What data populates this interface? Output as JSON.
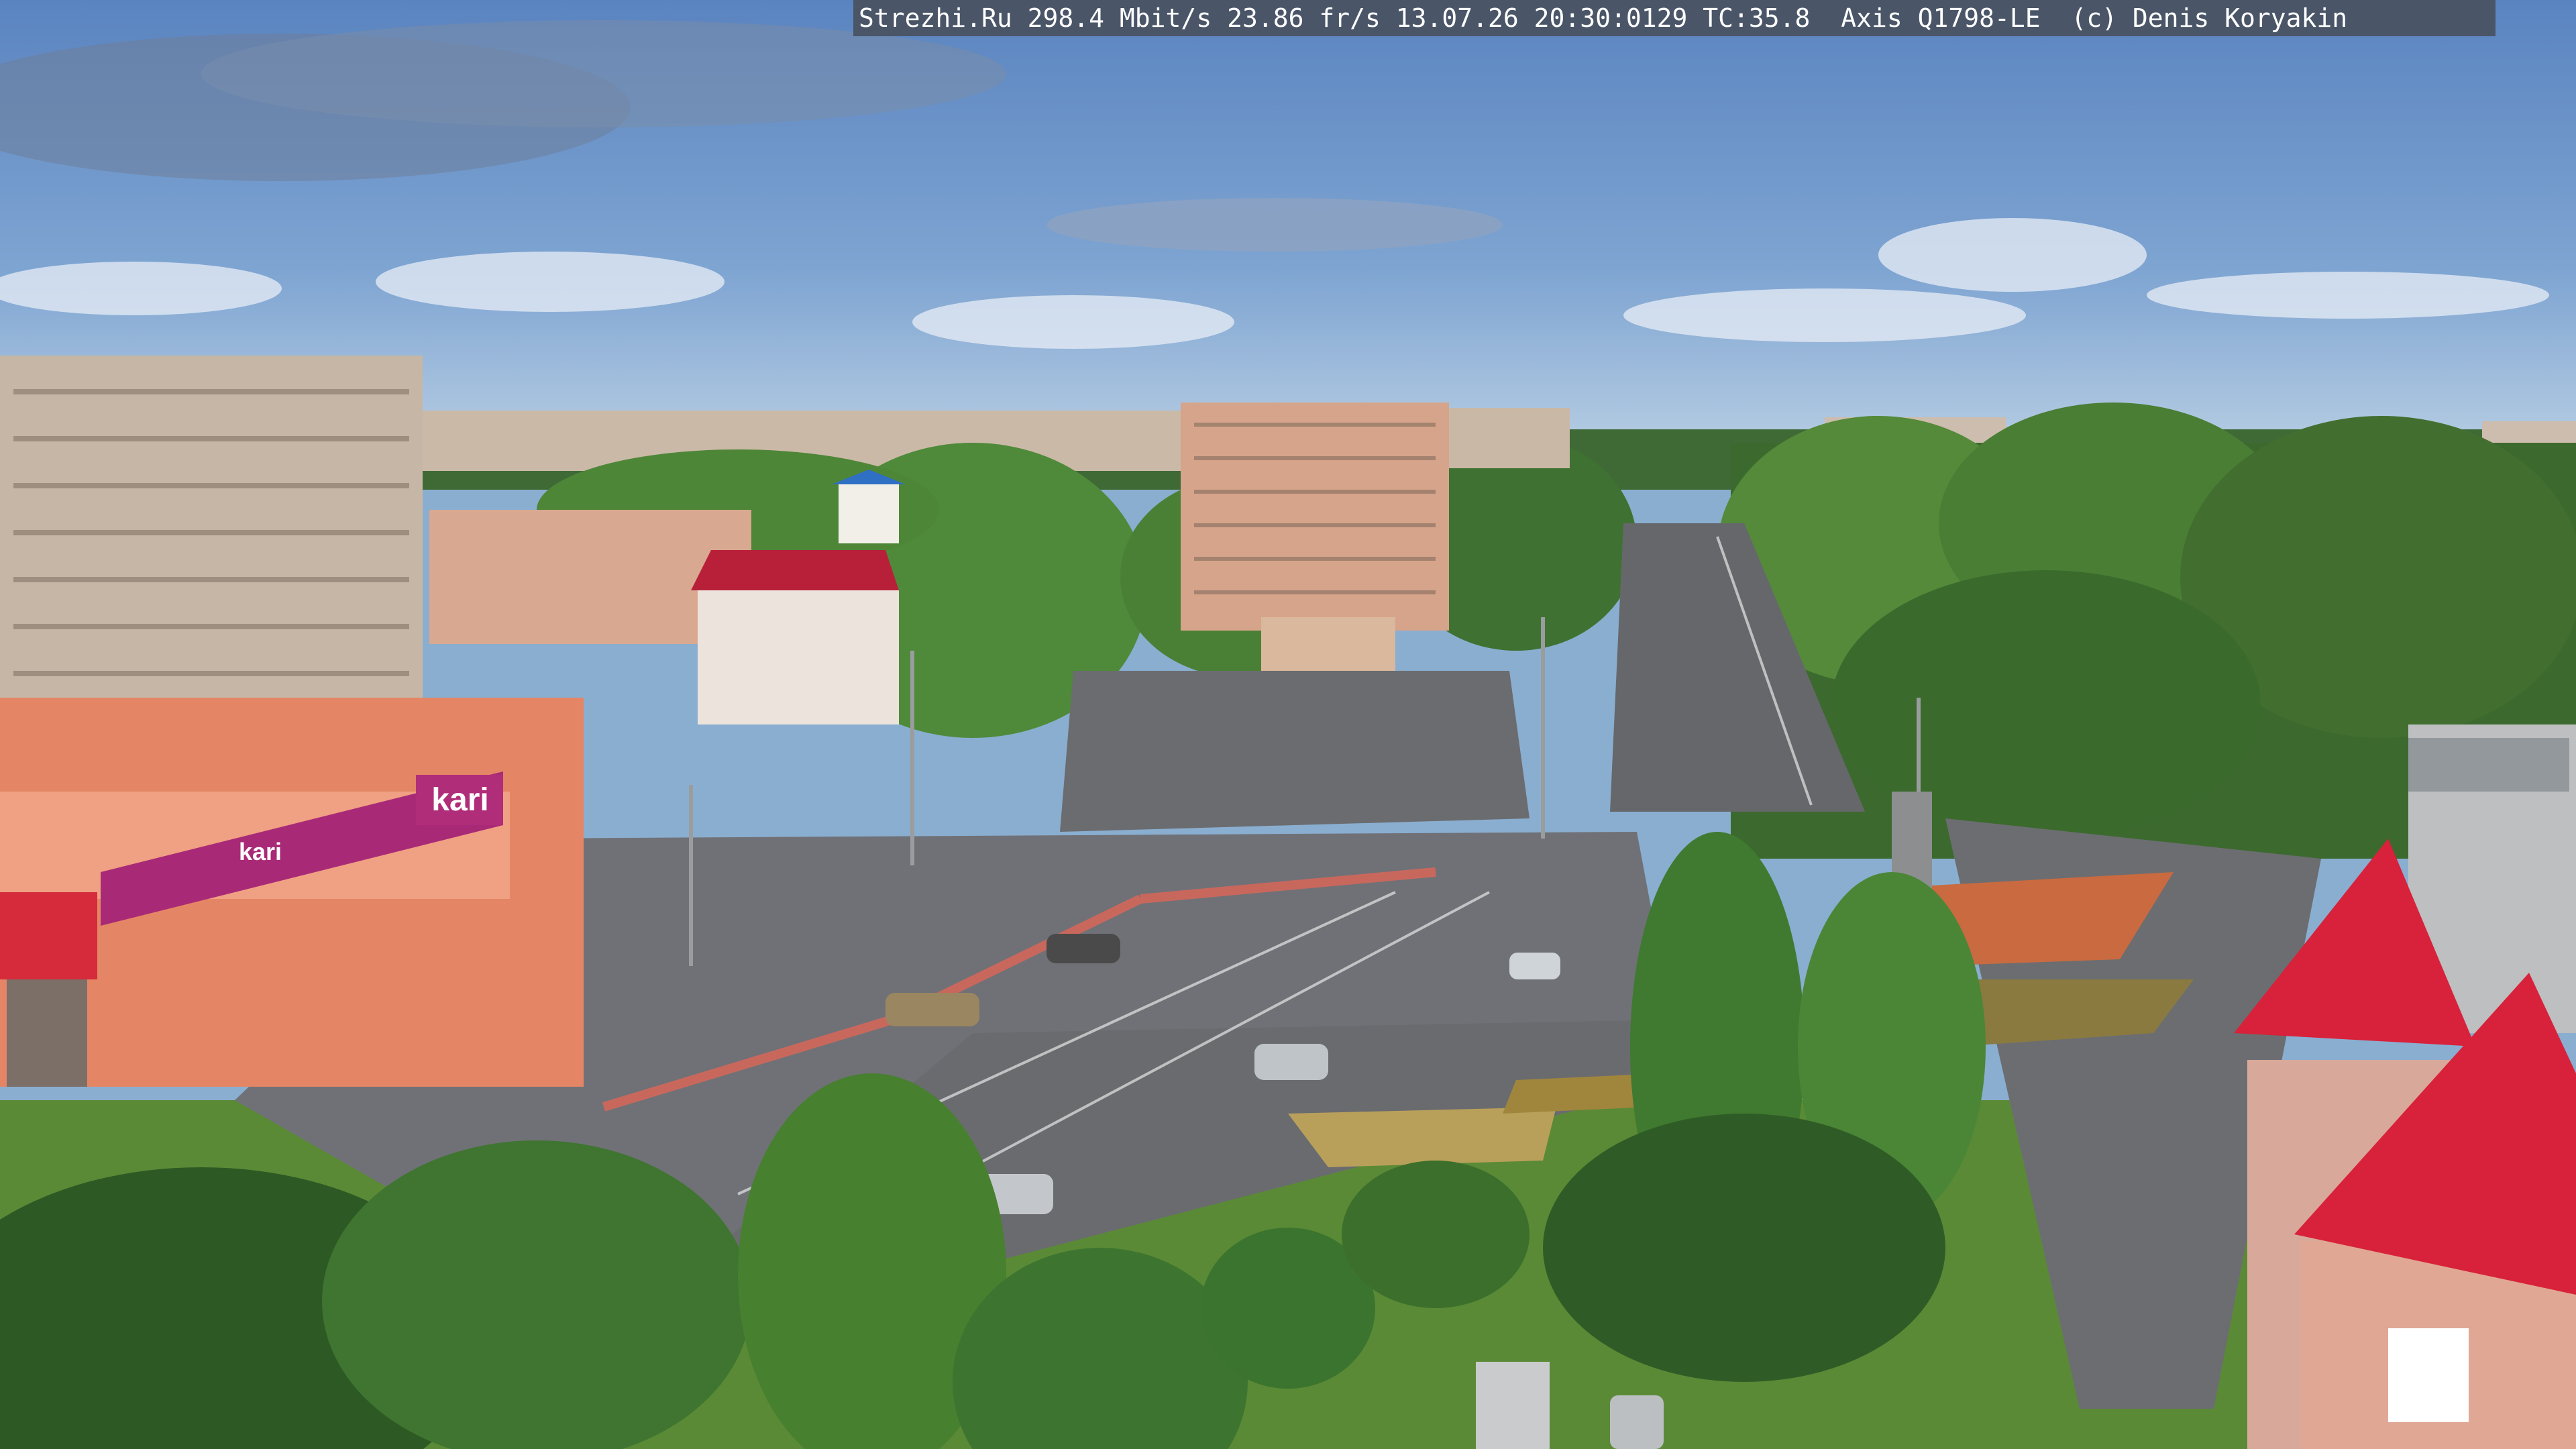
{
  "overlay": {
    "text": "Strezhi.Ru 298.4 Mbit/s 23.86 fr/s 13.07.26 20:30:0129 TC:35.8  Axis Q1798-LE  (c) Denis Koryakin"
  },
  "signs": {
    "store_logo": "kari",
    "store_logo_small": "kari"
  },
  "colors": {
    "sky_top": "#5d86c0",
    "sky_bottom": "#b6cde4",
    "asphalt": "#6e6f72",
    "grass": "#5e8c3a",
    "trees_dark": "#2f5a25",
    "trees_light": "#6e9a3e",
    "building_beige": "#c9b8a6",
    "building_salmon": "#e08a66",
    "roof_red": "#d8213a",
    "store_magenta": "#b02d7a"
  }
}
